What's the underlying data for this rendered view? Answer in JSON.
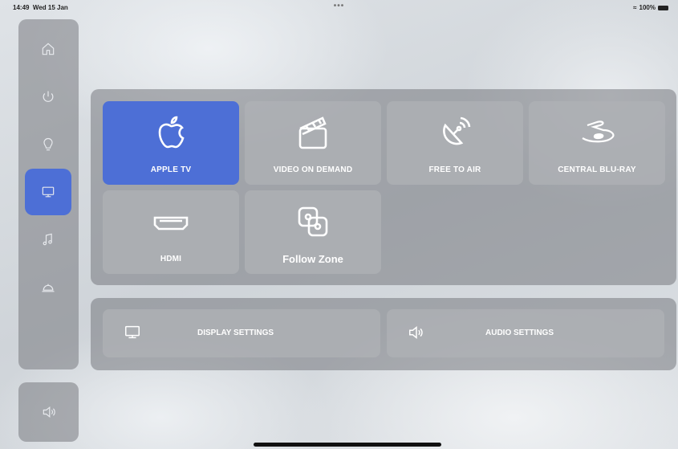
{
  "status_bar": {
    "time": "14:49",
    "date": "Wed 15 Jan",
    "dots": "•••",
    "battery": "100%"
  },
  "sidebar": {
    "items": [
      {
        "icon": "home-icon",
        "active": false
      },
      {
        "icon": "power-icon",
        "active": false
      },
      {
        "icon": "lightbulb-icon",
        "active": false
      },
      {
        "icon": "monitor-icon",
        "active": true
      },
      {
        "icon": "music-note-icon",
        "active": false
      },
      {
        "icon": "service-bell-icon",
        "active": false
      }
    ],
    "volume_icon": "speaker-icon"
  },
  "sources": [
    {
      "label": "APPLE TV",
      "icon": "apple-icon",
      "active": true
    },
    {
      "label": "VIDEO ON DEMAND",
      "icon": "clapperboard-icon",
      "active": false
    },
    {
      "label": "FREE TO AIR",
      "icon": "satellite-dish-icon",
      "active": false
    },
    {
      "label": "CENTRAL BLU-RAY",
      "icon": "bluray-icon",
      "active": false
    },
    {
      "label": "HDMI",
      "icon": "hdmi-icon",
      "active": false
    },
    {
      "label": "Follow Zone",
      "icon": "follow-zone-icon",
      "active": false
    }
  ],
  "settings": {
    "display_label": "DISPLAY SETTINGS",
    "audio_label": "AUDIO SETTINGS"
  },
  "colors": {
    "accent": "#4d6fd6",
    "tile": "#afb1b6",
    "panel": "#6e7076"
  }
}
